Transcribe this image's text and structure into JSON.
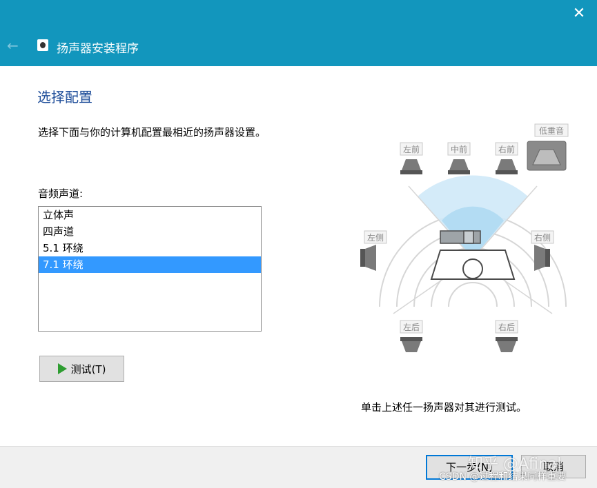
{
  "window": {
    "title": "扬声器安装程序",
    "close_glyph": "✕",
    "back_glyph": "←"
  },
  "page": {
    "heading": "选择配置",
    "description": "选择下面与你的计算机配置最相近的扬声器设置。",
    "channels_label": "音频声道:",
    "channels": [
      "立体声",
      "四声道",
      "5.1 环绕",
      "7.1 环绕"
    ],
    "selected_index": 3,
    "test_button": "测试(T)",
    "hint": "单击上述任一扬声器对其进行测试。"
  },
  "speakers": {
    "front_left": "左前",
    "front_center": "中前",
    "front_right": "右前",
    "subwoofer": "低重音",
    "side_left": "左侧",
    "side_right": "右侧",
    "rear_left": "左后",
    "rear_right": "右后"
  },
  "footer": {
    "next": "下一步(N)",
    "cancel": "取消"
  },
  "watermarks": {
    "zhihu": "知乎 @Afinal",
    "csdn": "CSDN @过程和结果同样重要"
  },
  "colors": {
    "titlebar": "#1296bd",
    "heading": "#1f4e9a",
    "selection": "#3399ff",
    "play": "#2e9d31"
  }
}
